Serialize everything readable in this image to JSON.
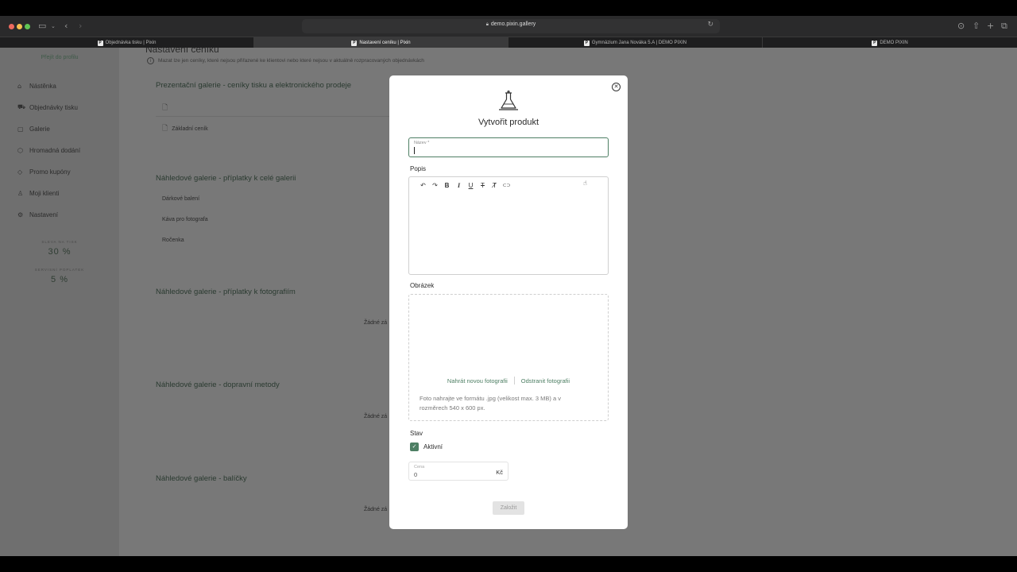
{
  "browser": {
    "url": "demo.pixin.gallery",
    "tabs": [
      {
        "label": "Objednávka tisku | Pixin",
        "active": false
      },
      {
        "label": "Nastavení ceníku | Pixin",
        "active": true
      },
      {
        "label": "Gymnázium Jana Nováka 5.A | DEMO PIXIN",
        "active": false
      },
      {
        "label": "DEMO PIXIN",
        "active": false
      }
    ],
    "favicon_letter": "P"
  },
  "sidebar": {
    "profile_link": "Přejít do profilu",
    "items": [
      {
        "label": "Nástěnka",
        "icon": "home-icon"
      },
      {
        "label": "Objednávky tisku",
        "icon": "cart-icon"
      },
      {
        "label": "Galerie",
        "icon": "gallery-icon"
      },
      {
        "label": "Hromadná dodání",
        "icon": "box-icon"
      },
      {
        "label": "Promo kupóny",
        "icon": "tag-icon"
      },
      {
        "label": "Moji klienti",
        "icon": "user-icon"
      },
      {
        "label": "Nastavení",
        "icon": "gear-icon"
      }
    ],
    "stats": [
      {
        "label": "SLEVA NA TISK",
        "value": "30 %"
      },
      {
        "label": "SERVISNÍ POPLATEK",
        "value": "5 %"
      }
    ]
  },
  "main": {
    "title": "Nastavení ceníků",
    "info": "Mazat lze jen ceníky, které nejsou přiřazené ke klientovi nebo které nejsou v aktuálně rozpracovaných objednávkách",
    "sections": [
      {
        "title": "Prezentační galerie - ceníky tisku a elektronického prodeje",
        "items": [
          "",
          "Základní ceník"
        ]
      },
      {
        "title": "Náhledové galerie - příplatky k celé galerii",
        "items": [
          "Dárkové balení",
          "Káva pro fotografa",
          "Ročenka"
        ]
      },
      {
        "title": "Náhledové galerie - příplatky k fotografiím",
        "empty": "Žádné zá"
      },
      {
        "title": "Náhledové galerie - dopravní metody",
        "empty": "Žádné zá"
      },
      {
        "title": "Náhledové galerie - balíčky",
        "empty": "Žádné zá"
      }
    ]
  },
  "modal": {
    "close_icon": "close-icon",
    "icon": "flask-icon",
    "title": "Vytvořit produkt",
    "name_label": "Název *",
    "name_value": "",
    "description_label": "Popis",
    "toolbar": {
      "undo": "↶",
      "redo": "↷",
      "bold": "B",
      "italic": "I",
      "underline": "U",
      "strike": "T",
      "clear": "T̸",
      "link": "⊂⊃"
    },
    "image_label": "Obrázek",
    "upload_link": "Nahrát novou fotografii",
    "remove_link": "Odstranit fotografii",
    "image_hint": "Foto nahrajte ve formátu .jpg (velikost max. 3 MB) a v rozměrech 540 x 600 px.",
    "status_label": "Stav",
    "active_label": "Aktivní",
    "active_checked": true,
    "price_label": "Cena",
    "price_value": "0",
    "currency": "Kč",
    "submit_label": "Založit"
  },
  "colors": {
    "accent": "#4e7f64",
    "overlay": "#787878"
  }
}
